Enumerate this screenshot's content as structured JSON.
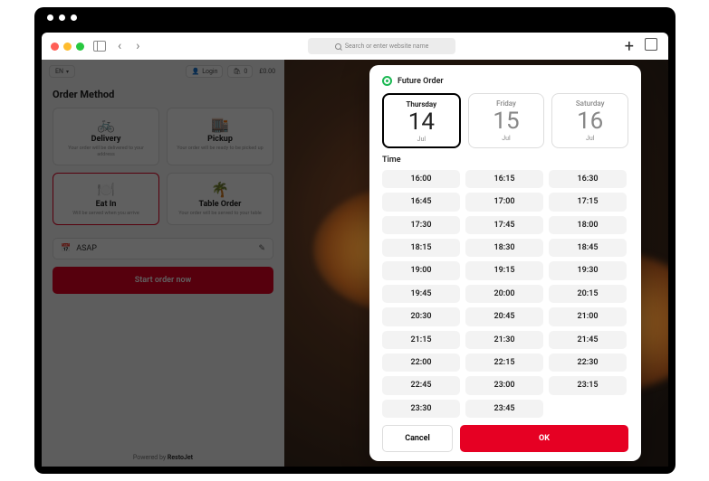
{
  "browser": {
    "search_placeholder": "Search or enter website name"
  },
  "topbar": {
    "lang": "EN",
    "login": "Login",
    "cart_count": "0",
    "cart_total": "£0.00"
  },
  "order_method": {
    "title": "Order Method",
    "options": [
      {
        "icon": "🚲",
        "label": "Delivery",
        "desc": "Your order will be delivered to your address"
      },
      {
        "icon": "🏬",
        "label": "Pickup",
        "desc": "Your order will be ready to be picked up"
      },
      {
        "icon": "🍽️",
        "label": "Eat In",
        "desc": "Will be served when you arrive"
      },
      {
        "icon": "🌴",
        "label": "Table Order",
        "desc": "Your order will be served to your table"
      }
    ],
    "selected_index": 2
  },
  "schedule": {
    "value": "ASAP"
  },
  "start_button": "Start order now",
  "powered_prefix": "Powered by ",
  "powered_brand": "RestoJet",
  "modal": {
    "title": "Future Order",
    "dates": [
      {
        "dow": "Thursday",
        "day": "14",
        "month": "Jul"
      },
      {
        "dow": "Friday",
        "day": "15",
        "month": "Jul"
      },
      {
        "dow": "Saturday",
        "day": "16",
        "month": "Jul"
      }
    ],
    "selected_date_index": 0,
    "time_label": "Time",
    "times": [
      "16:00",
      "16:15",
      "16:30",
      "16:45",
      "17:00",
      "17:15",
      "17:30",
      "17:45",
      "18:00",
      "18:15",
      "18:30",
      "18:45",
      "19:00",
      "19:15",
      "19:30",
      "19:45",
      "20:00",
      "20:15",
      "20:30",
      "20:45",
      "21:00",
      "21:15",
      "21:30",
      "21:45",
      "22:00",
      "22:15",
      "22:30",
      "22:45",
      "23:00",
      "23:15",
      "23:30",
      "23:45"
    ],
    "cancel": "Cancel",
    "ok": "OK"
  }
}
